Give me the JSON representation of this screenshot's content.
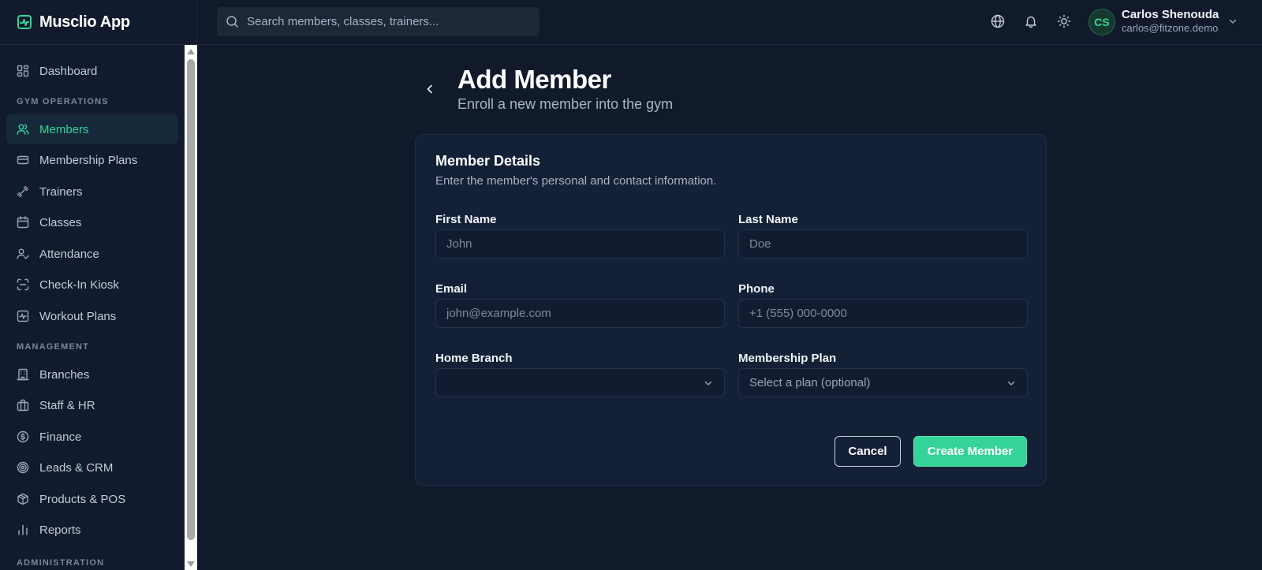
{
  "app": {
    "name": "Musclio App"
  },
  "search": {
    "placeholder": "Search members, classes, trainers..."
  },
  "user": {
    "initials": "CS",
    "name": "Carlos Shenouda",
    "email": "carlos@fitzone.demo"
  },
  "sidebar": {
    "dashboard": "Dashboard",
    "section_gym": "GYM OPERATIONS",
    "members": "Members",
    "membership_plans": "Membership Plans",
    "trainers": "Trainers",
    "classes": "Classes",
    "attendance": "Attendance",
    "check_in_kiosk": "Check-In Kiosk",
    "workout_plans": "Workout Plans",
    "section_management": "MANAGEMENT",
    "branches": "Branches",
    "staff_hr": "Staff & HR",
    "finance": "Finance",
    "leads_crm": "Leads & CRM",
    "products_pos": "Products & POS",
    "reports": "Reports",
    "section_admin": "ADMINISTRATION"
  },
  "page": {
    "title": "Add Member",
    "subtitle": "Enroll a new member into the gym"
  },
  "form": {
    "card_title": "Member Details",
    "card_desc": "Enter the member's personal and contact information.",
    "first_name": {
      "label": "First Name",
      "placeholder": "John",
      "value": ""
    },
    "last_name": {
      "label": "Last Name",
      "placeholder": "Doe",
      "value": ""
    },
    "email": {
      "label": "Email",
      "placeholder": "john@example.com",
      "value": ""
    },
    "phone": {
      "label": "Phone",
      "placeholder": "+1 (555) 000-0000",
      "value": ""
    },
    "home_branch": {
      "label": "Home Branch",
      "value": ""
    },
    "membership_plan": {
      "label": "Membership Plan",
      "value": "Select a plan (optional)"
    },
    "cancel": "Cancel",
    "create": "Create Member"
  },
  "colors": {
    "accent": "#34d399",
    "background": "#111a2b",
    "card": "#132036"
  }
}
